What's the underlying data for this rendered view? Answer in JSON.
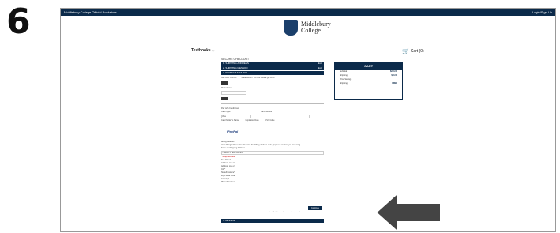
{
  "step_number": "6",
  "topbar": {
    "left": "Middlebury College Official Bookstore",
    "right": "Login/Sign Up"
  },
  "logo": {
    "line1": "Middlebury",
    "line2": "College"
  },
  "nav": {
    "textbooks": "Textbooks ⌄",
    "cart": "Cart (0)"
  },
  "checkout": {
    "section_title": "SECURE CHECKOUT",
    "steps": [
      {
        "label": "1. SHIPPING ADDRESS",
        "action": "Edit"
      },
      {
        "label": "2. SHIPPING METHOD",
        "action": "Edit"
      },
      {
        "label": "3. PAYMENT METHOD",
        "action": ""
      }
    ],
    "gift_card_label": "Gift Card Number",
    "gift_card_note": "Balance/PIN *Do you have a gift card?",
    "promo_label": "Promo Code",
    "pay_option": "Pay with Credit Card",
    "card_type": "Card Type",
    "card_type_value": "Visa",
    "card_number": "Card Number",
    "cardholder": "Card Holder's Name",
    "exp_date": "Expiration Date",
    "cvv": "CVV Code",
    "paypal": "PayPal",
    "billing_title": "Billing Address",
    "billing_note": "Your billing address should match the billing address of the payment method you are using.",
    "same_address": "Same as Shipping Address",
    "select_address": "-- Select or add Address",
    "required_note": "* Required field",
    "fields": [
      "Full Name*",
      "Address Line 1*",
      "Address Line 2",
      "City*",
      "State/Province*",
      "Zip/Postal Code*",
      "Country*",
      "Phone Number*"
    ],
    "state_value": "Select a State",
    "country_value": "United States of America",
    "submit_label": "Continue",
    "submit_note": "You will still have a chance to review your order.",
    "review_label": "4. REVIEW"
  },
  "cart": {
    "title": "CART",
    "subtotal_label": "Subtotal",
    "subtotal_value": "$243.00",
    "shipping_label": "Shipping",
    "shipping_value": "$20.00",
    "discount_label": "Price Savings",
    "total_label": "Shipping",
    "total_value": "FREE"
  },
  "colors": {
    "navy": "#0b2a4a",
    "arrow": "#444444"
  }
}
